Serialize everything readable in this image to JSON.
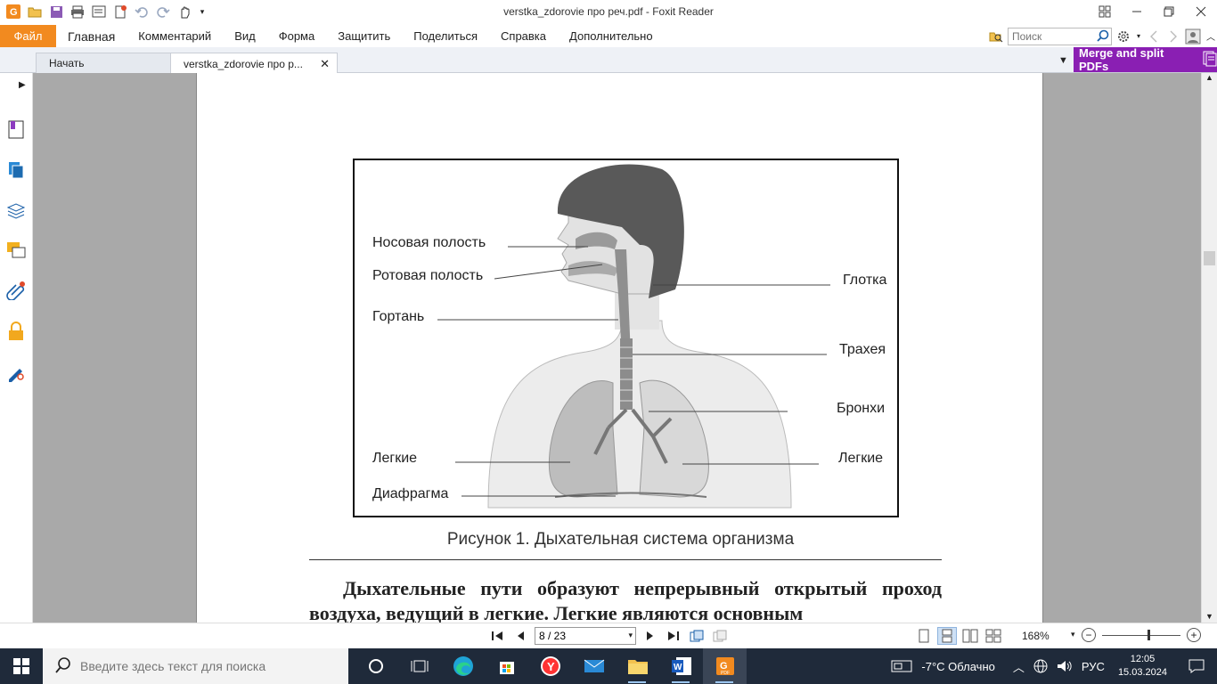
{
  "window": {
    "title": "verstka_zdorovie про реч.pdf - Foxit Reader",
    "controls": [
      "restore-layout",
      "minimize",
      "maximize",
      "close"
    ]
  },
  "menu": {
    "file": "Файл",
    "items": [
      "Главная",
      "Комментарий",
      "Вид",
      "Форма",
      "Защитить",
      "Поделиться",
      "Справка",
      "Дополнительно"
    ]
  },
  "search": {
    "placeholder": "Поиск"
  },
  "tabs": [
    {
      "label": "Начать"
    },
    {
      "label": "verstka_zdorovie про р...",
      "close": "✕"
    }
  ],
  "promo": {
    "label": "Merge and split PDFs"
  },
  "left_panel": {
    "icons": [
      "bookmark-icon",
      "pages-icon",
      "layers-icon",
      "comments-icon",
      "attachments-icon",
      "security-lock-icon",
      "signature-icon"
    ]
  },
  "document": {
    "figure": {
      "labels": {
        "nasal": "Носовая полость",
        "oral": "Ротовая полость",
        "larynx": "Гортань",
        "pharynx": "Глотка",
        "trachea": "Трахея",
        "bronchi": "Бронхи",
        "lungs_left": "Легкие",
        "lungs_right": "Легкие",
        "diaphragm": "Диафрагма"
      }
    },
    "caption": "Рисунок 1. Дыхательная система организма",
    "body": "Дыхательные пути образуют непрерывный открытый проход воздуха, ведущий в легкие. Легкие являются основным"
  },
  "status": {
    "page_value": "8 / 23",
    "zoom": "168%",
    "zoom_level_fraction": 0.58
  },
  "taskbar": {
    "search_placeholder": "Введите здесь текст для поиска",
    "weather": "-7°C  Облачно",
    "lang": "РУС",
    "time": "12:05",
    "date": "15.03.2024",
    "colors": {
      "foxit_orange": "#f28a1f",
      "promo_purple": "#8a1fb3",
      "taskbar": "#1f2a3a"
    }
  }
}
